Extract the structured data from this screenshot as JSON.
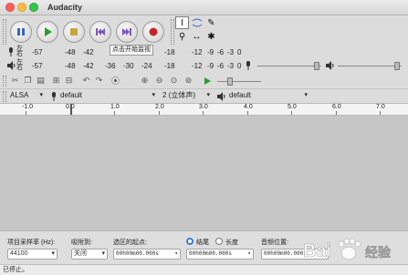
{
  "window": {
    "title": "Audacity"
  },
  "transport": {
    "pause": "pause-icon",
    "play": "play-icon",
    "stop": "stop-icon",
    "skip_start": "skip-to-start-icon",
    "skip_end": "skip-to-end-icon",
    "record": "record-icon"
  },
  "meters": {
    "record": {
      "left": "左",
      "right": "右",
      "ticks": [
        "-57",
        "-48",
        "-42",
        "-18",
        "-12",
        "-9",
        "-6",
        "-3",
        "0"
      ],
      "tooltip": "点击开始监视"
    },
    "playback": {
      "left": "左",
      "right": "右",
      "ticks": [
        "-57",
        "-48",
        "-42",
        "-36",
        "-30",
        "-24",
        "-18",
        "-12",
        "-9",
        "-6",
        "-3",
        "0"
      ]
    }
  },
  "devices": {
    "host": "ALSA",
    "recording_device": "default",
    "channels": "2 (立体声)",
    "playback_device": "default"
  },
  "ruler": {
    "labels": [
      "-1.0",
      "0.0",
      "1.0",
      "2.0",
      "3.0",
      "4.0",
      "5.0",
      "6.0",
      "7.0"
    ]
  },
  "selection_bar": {
    "project_rate_label": "项目采样率 (Hz):",
    "project_rate_value": "44100",
    "snap_label": "吸附到:",
    "snap_value": "关闭",
    "start_label": "选区的起点:",
    "start_value": "00h00m00.000s",
    "end_label": "结尾",
    "length_label": "长度",
    "end_value": "00h00m00.000s",
    "audio_position_label": "音频位置:",
    "audio_position_value": "00h00m00.000s"
  },
  "status": {
    "text": "已停止。"
  },
  "watermark": {
    "brand": "Bai",
    "brand2": "经验"
  },
  "colors": {
    "play": "#2a9d2a",
    "record": "#c8252b",
    "accent": "#3a7cd8"
  }
}
